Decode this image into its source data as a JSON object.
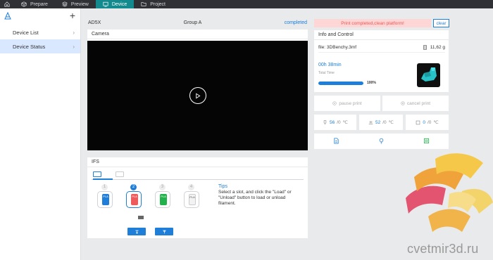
{
  "topbar": {
    "tabs": [
      {
        "label": "Prepare",
        "icon": "cube-icon"
      },
      {
        "label": "Preview",
        "icon": "layers-icon"
      },
      {
        "label": "Device",
        "icon": "monitor-icon"
      },
      {
        "label": "Project",
        "icon": "folder-icon"
      }
    ],
    "active_tab": "Device"
  },
  "sidebar": {
    "items": [
      {
        "label": "Device List"
      },
      {
        "label": "Device Status"
      }
    ],
    "active": "Device Status"
  },
  "device": {
    "name": "AD5X",
    "group": "Group A",
    "status": "completed"
  },
  "camera": {
    "title": "Camera"
  },
  "ifs": {
    "title": "IFS",
    "slots": [
      {
        "num": "1",
        "color": "#1e7ed8",
        "label": "PLA"
      },
      {
        "num": "2",
        "color": "#ef5a5a",
        "label": "PLA"
      },
      {
        "num": "3",
        "color": "#22b24c",
        "label": "PLA"
      },
      {
        "num": "4",
        "color": "#f2f2f2",
        "label": "PLA"
      }
    ],
    "selected_slot": "2",
    "tips_title": "Tips",
    "tips_text": "Select a slot, and click the \"Load\" or \"Unload\" button to load or unload filament."
  },
  "notice": {
    "message": "Print completed,clean platform!",
    "clear_label": "clear"
  },
  "info": {
    "title": "Info and Control",
    "file": "file: 3DBenchy.3mf",
    "weight": "11,62 g",
    "time": "00h 38min",
    "total_time_label": "Total Time",
    "progress_percent": 100,
    "progress_label": "100%"
  },
  "controls": {
    "pause_label": "pause print",
    "cancel_label": "cancel print"
  },
  "temps": [
    {
      "icon": "nozzle-icon",
      "current": "56",
      "target": "/0",
      "unit": "℃"
    },
    {
      "icon": "bed-icon",
      "current": "52",
      "target": "/0",
      "unit": "℃"
    },
    {
      "icon": "chamber-icon",
      "current": "0",
      "target": "/0",
      "unit": "℃"
    }
  ],
  "bottom_icons": [
    "file-icon",
    "light-icon",
    "filter-icon"
  ],
  "watermark": "cvetmir3d.ru",
  "colors": {
    "accent": "#1e7ed8",
    "teal_tab": "#138a8e",
    "alert_bg": "#ffd6d6",
    "alert_text": "#e55555"
  }
}
